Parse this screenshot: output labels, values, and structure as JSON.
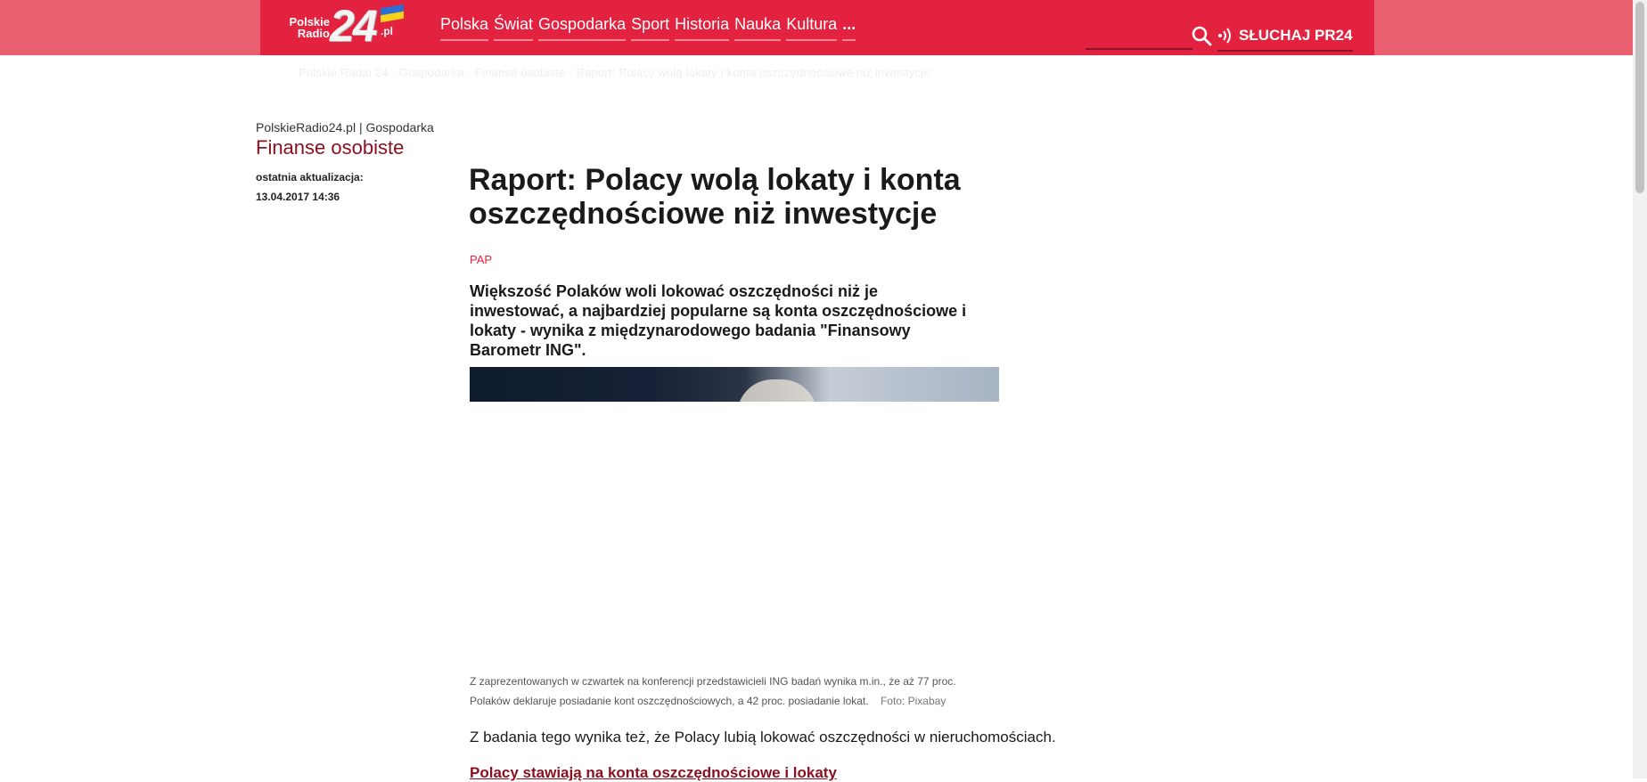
{
  "header": {
    "logo_text_line1": "Polskie",
    "logo_text_line2": "Radio",
    "logo_number": "24",
    "logo_suffix": ".pl",
    "nav": [
      "Polska",
      "Świat",
      "Gospodarka",
      "Sport",
      "Historia",
      "Nauka",
      "Kultura",
      "..."
    ],
    "search_icon": "search-icon",
    "listen_icon": "broadcast-icon",
    "listen_label": "SŁUCHAJ PR24",
    "brand_color": "#e2223f",
    "flag_colors": [
      "#2a6fd1",
      "#f6d21c"
    ]
  },
  "faint_breadcrumb": "Polskie Radio 24 · Gospodarka · Finanse osobiste · Raport: Polacy wolą lokaty i konta oszczędnościowe niż inwestycje",
  "section": {
    "site": "PolskieRadio24.pl",
    "separator": "|",
    "category": "Gospodarka",
    "title": "Finanse osobiste",
    "updated_label": "ostatnia aktualizacja:",
    "updated_date": "13.04.2017 14:36"
  },
  "article": {
    "headline": "Raport: Polacy wolą lokaty i konta oszczędnościowe niż inwestycje",
    "source": "PAP",
    "lead": "Większość Polaków woli lokować oszczędności niż je inwestować, a najbardziej popularne są konta oszczędnościowe i lokaty - wynika z międzynarodowego badania \"Finansowy Barometr ING\".",
    "caption": "Z zaprezentowanych w czwartek na konferencji przedstawicieli ING badań wynika m.in., że aż 77 proc. Polaków deklaruje posiadanie kont oszczędnościowych, a 42 proc. posiadanie lokat.",
    "photo_credit": "Foto: Pixabay",
    "paragraph": "Z badania tego wynika też, że Polacy lubią lokować oszczędności w nieruchomościach.",
    "subheading": "Polacy stawiają na konta oszczędnościowe i lokaty"
  }
}
